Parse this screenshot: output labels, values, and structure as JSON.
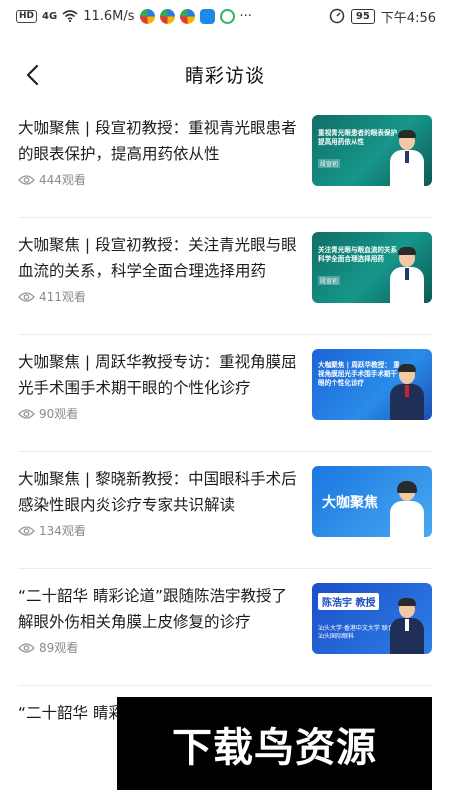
{
  "status_bar": {
    "hd": "HD",
    "signal": "4G",
    "speed": "11.6M/s",
    "dots": "···",
    "battery": "95",
    "time": "下午4:56"
  },
  "header": {
    "title": "睛彩访谈",
    "back_icon": "chevron-left-icon"
  },
  "items": [
    {
      "title": "大咖聚焦 | 段宣初教授：重视青光眼患者的眼表保护，提高用药依从性",
      "views": "444观看",
      "thumb_text": "重视青光眼患者的眼表保护 提高用药依从性",
      "thumb_name": "段宣初",
      "thumb_style": "green"
    },
    {
      "title": "大咖聚焦 | 段宣初教授：关注青光眼与眼血流的关系，科学全面合理选择用药",
      "views": "411观看",
      "thumb_text": "关注青光眼与眼血流的关系 科学全面合理选择用药",
      "thumb_name": "段宣初",
      "thumb_style": "green"
    },
    {
      "title": "大咖聚焦 | 周跃华教授专访：重视角膜屈光手术围手术期干眼的个性化诊疗",
      "views": "90观看",
      "thumb_text": "大咖聚焦 | 周跃华教授： 重视角膜屈光手术围手术期干眼的个性化诊疗",
      "thumb_name": "",
      "thumb_style": "blue"
    },
    {
      "title": "大咖聚焦 | 黎晓新教授：中国眼科手术后感染性眼内炎诊疗专家共识解读",
      "views": "134观看",
      "thumb_text": "大咖聚焦",
      "thumb_name": "",
      "thumb_style": "blue2"
    },
    {
      "title": "“二十韶华 睛彩论道”跟随陈浩宇教授了解眼外伤相关角膜上皮修复的诊疗",
      "views": "89观看",
      "thumb_text": "汕头大学·香港中文大学 联合汕头国际眼科",
      "thumb_name": "陈浩宇 教授",
      "thumb_style": "navy"
    },
    {
      "title": "“二十韶华 睛彩论道”眼的临床诊疗",
      "views": "",
      "thumb_text": "",
      "thumb_name": "",
      "thumb_style": "none"
    }
  ],
  "watermark": "下载鸟资源",
  "colors": {
    "title": "#1c1c1c",
    "muted": "#8a8a8a",
    "divider": "#ececec",
    "thumb_green": "#17968a",
    "thumb_blue": "#2a8ce8"
  }
}
